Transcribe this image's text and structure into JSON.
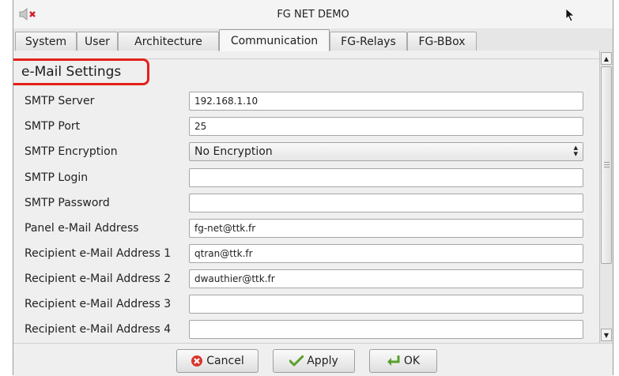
{
  "window": {
    "title": "FG NET DEMO"
  },
  "tabs": [
    {
      "label": "System"
    },
    {
      "label": "User"
    },
    {
      "label": "Architecture"
    },
    {
      "label": "Communication",
      "active": true
    },
    {
      "label": "FG-Relays"
    },
    {
      "label": "FG-BBox"
    }
  ],
  "section": {
    "title": "e-Mail Settings"
  },
  "fields": [
    {
      "label": "SMTP Server",
      "value": "192.168.1.10"
    },
    {
      "label": "SMTP Port",
      "value": "25"
    },
    {
      "label": "SMTP Encryption",
      "value": "No Encryption",
      "type": "select"
    },
    {
      "label": "SMTP Login",
      "value": ""
    },
    {
      "label": "SMTP Password",
      "value": ""
    },
    {
      "label": "Panel e-Mail Address",
      "value": "fg-net@ttk.fr"
    },
    {
      "label": "Recipient e-Mail Address 1",
      "value": "qtran@ttk.fr"
    },
    {
      "label": "Recipient e-Mail Address 2",
      "value": "dwauthier@ttk.fr"
    },
    {
      "label": "Recipient e-Mail Address 3",
      "value": ""
    },
    {
      "label": "Recipient e-Mail Address 4",
      "value": ""
    }
  ],
  "buttons": {
    "cancel_label": "Cancel",
    "apply_label": "Apply",
    "ok_label": "OK"
  },
  "colors": {
    "highlight": "#e5201a",
    "cancel_icon": "#d9342b",
    "check_icon": "#5aa02c"
  }
}
